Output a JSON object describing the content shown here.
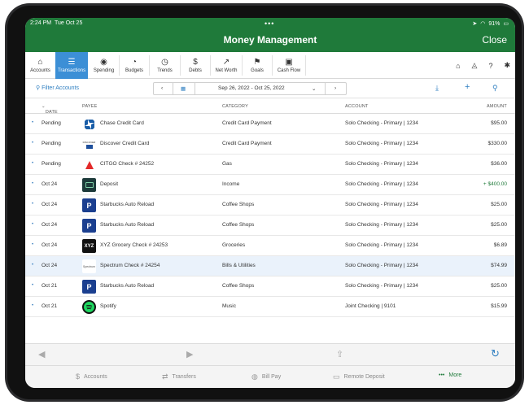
{
  "status": {
    "time": "2:24 PM",
    "date": "Tue Oct 25",
    "battery": "91%"
  },
  "header": {
    "title": "Money Management",
    "close": "Close"
  },
  "tabs": [
    {
      "label": "Accounts",
      "icon": "bank-icon"
    },
    {
      "label": "Transactions",
      "icon": "list-icon"
    },
    {
      "label": "Spending",
      "icon": "spending-icon"
    },
    {
      "label": "Budgets",
      "icon": "budget-icon"
    },
    {
      "label": "Trends",
      "icon": "trends-icon"
    },
    {
      "label": "Debts",
      "icon": "debts-icon"
    },
    {
      "label": "Net Worth",
      "icon": "net-worth-icon"
    },
    {
      "label": "Goals",
      "icon": "goals-icon"
    },
    {
      "label": "Cash Flow",
      "icon": "cash-flow-icon"
    }
  ],
  "filterbar": {
    "filter_label": "Filter Accounts",
    "date_range": "Sep 26, 2022 - Oct 25, 2022"
  },
  "columns": {
    "date": "DATE",
    "payee": "PAYEE",
    "category": "CATEGORY",
    "account": "ACCOUNT",
    "amount": "AMOUNT"
  },
  "transactions": [
    {
      "date": "Pending",
      "payee": "Chase Credit Card",
      "category": "Credit Card Payment",
      "account": "Solo Checking - Primary | 1234",
      "amount": "$95.00"
    },
    {
      "date": "Pending",
      "payee": "Discover Credit Card",
      "category": "Credit Card Payment",
      "account": "Solo Checking - Primary | 1234",
      "amount": "$330.00"
    },
    {
      "date": "Pending",
      "payee": "CITGO Check # 24252",
      "category": "Gas",
      "account": "Solo Checking - Primary | 1234",
      "amount": "$36.00"
    },
    {
      "date": "Oct 24",
      "payee": "Deposit",
      "category": "Income",
      "account": "Solo Checking - Primary | 1234",
      "amount": "+ $400.00"
    },
    {
      "date": "Oct 24",
      "payee": "Starbucks Auto Reload",
      "category": "Coffee Shops",
      "account": "Solo Checking - Primary | 1234",
      "amount": "$25.00"
    },
    {
      "date": "Oct 24",
      "payee": "Starbucks Auto Reload",
      "category": "Coffee Shops",
      "account": "Solo Checking - Primary | 1234",
      "amount": "$25.00"
    },
    {
      "date": "Oct 24",
      "payee": "XYZ Grocery Check # 24253",
      "category": "Groceries",
      "account": "Solo Checking - Primary | 1234",
      "amount": "$6.89"
    },
    {
      "date": "Oct 24",
      "payee": "Spectrum Check # 24254",
      "category": "Bills & Utilities",
      "account": "Solo Checking - Primary | 1234",
      "amount": "$74.99"
    },
    {
      "date": "Oct 21",
      "payee": "Starbucks Auto Reload",
      "category": "Coffee Shops",
      "account": "Solo Checking - Primary | 1234",
      "amount": "$25.00"
    },
    {
      "date": "Oct 21",
      "payee": "Spotify",
      "category": "Music",
      "account": "Joint Checking | 9101",
      "amount": "$15.99"
    }
  ],
  "logos": {
    "discover": "DISCOVER",
    "xyz": "XYZ",
    "spectrum": "Spectrum"
  },
  "bottomnav": {
    "accounts": "Accounts",
    "transfers": "Transfers",
    "billpay": "Bill Pay",
    "remote": "Remote Deposit",
    "more": "More"
  },
  "colors": {
    "brand_green": "#1f7a3a",
    "active_tab": "#3c8fd6",
    "link_blue": "#2f7fc1"
  }
}
